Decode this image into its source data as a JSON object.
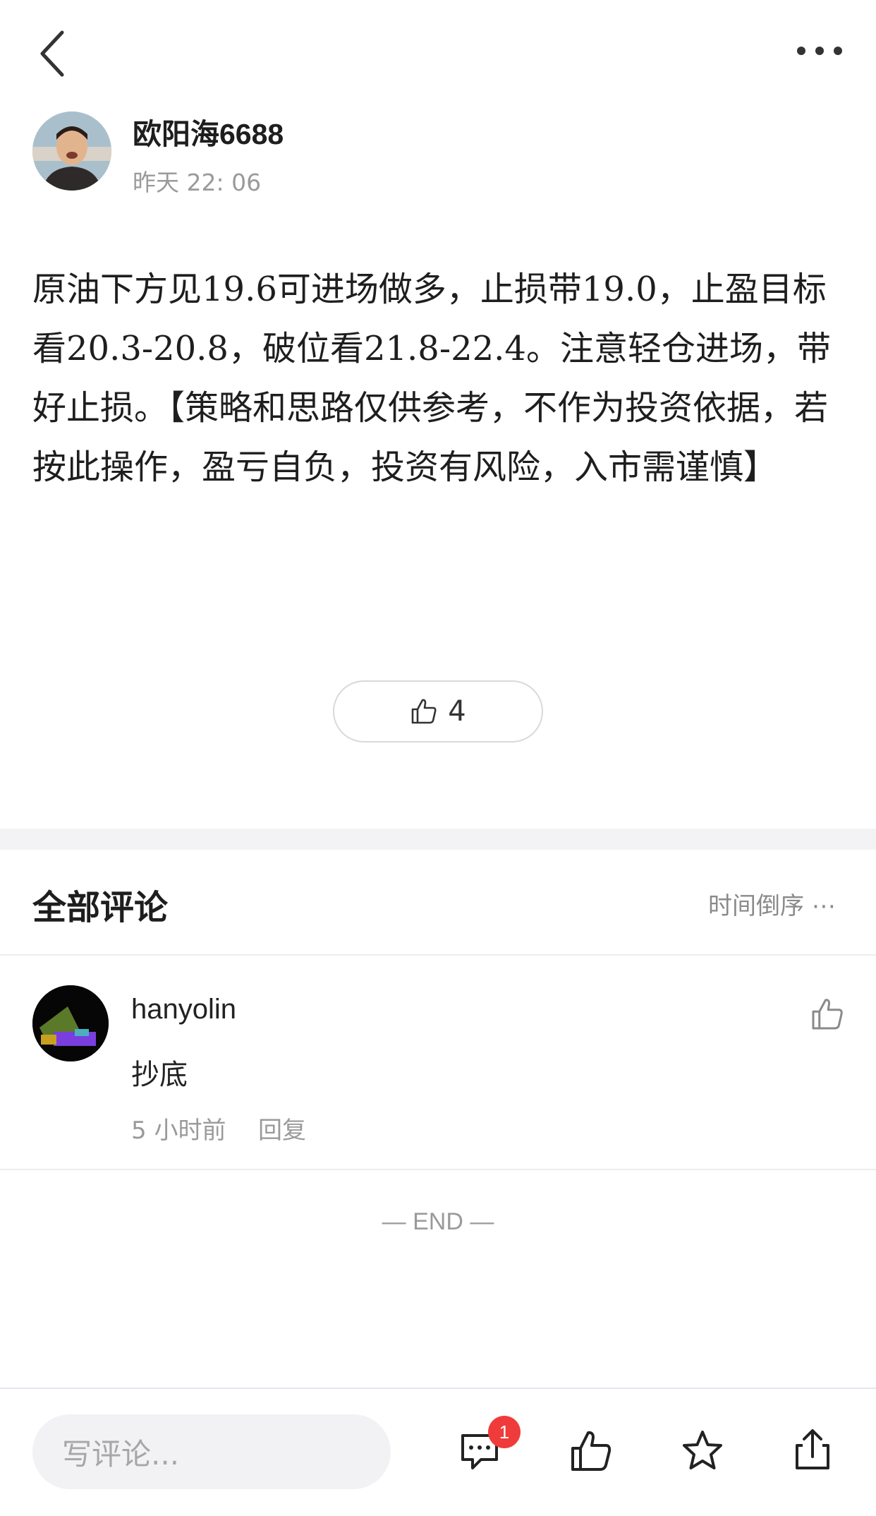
{
  "header": {
    "back_icon": "chevron-left-icon",
    "more_icon": "more-dots-icon"
  },
  "post": {
    "author": "欧阳海6688",
    "time": "昨天 22: 06",
    "body": "原油下方见19.6可进场做多，止损带19.0，止盈目标看20.3-20.8，破位看21.8-22.4。注意轻仓进场，带好止损。【策略和思路仅供参考，不作为投资依据，若按此操作，盈亏自负，投资有风险，入市需谨慎】",
    "like_count": "4"
  },
  "comments_section": {
    "title": "全部评论",
    "sort_label": "时间倒序 ⋯",
    "items": [
      {
        "user": "hanyolin",
        "text": "抄底",
        "time": "5 小时前",
        "reply_label": "回复"
      }
    ],
    "end_label": "— END —"
  },
  "bottom_bar": {
    "input_placeholder": "写评论...",
    "comment_badge": "1",
    "icons": [
      "comment-icon",
      "thumbs-up-icon",
      "star-icon",
      "share-icon"
    ],
    "badge_color": "#f03b3b"
  }
}
